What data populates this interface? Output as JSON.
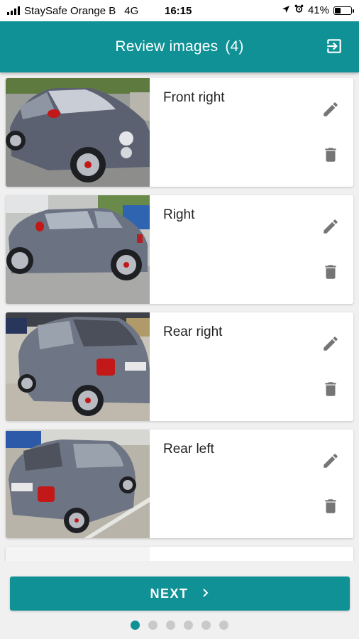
{
  "status_bar": {
    "carrier": "StaySafe Orange B",
    "network": "4G",
    "time": "16:15",
    "battery": "41%",
    "battery_level": 0.41
  },
  "header": {
    "title": "Review images",
    "count": "(4)",
    "logout_icon": "logout-icon"
  },
  "images": [
    {
      "label": "Front right",
      "thumbnail": "car-front-right-photo"
    },
    {
      "label": "Right",
      "thumbnail": "car-right-photo"
    },
    {
      "label": "Rear right",
      "thumbnail": "car-rear-right-photo"
    },
    {
      "label": "Rear left",
      "thumbnail": "car-rear-left-photo"
    }
  ],
  "actions": {
    "edit_icon": "pencil-icon",
    "delete_icon": "trash-icon"
  },
  "footer": {
    "next_label": "NEXT",
    "next_icon": "chevron-right-icon",
    "pager": {
      "total": 6,
      "active_index": 0
    }
  },
  "colors": {
    "primary": "#0f9196",
    "background": "#f0f0f0",
    "card": "#ffffff",
    "icon": "#757575",
    "dot_inactive": "#c9c9c9"
  }
}
